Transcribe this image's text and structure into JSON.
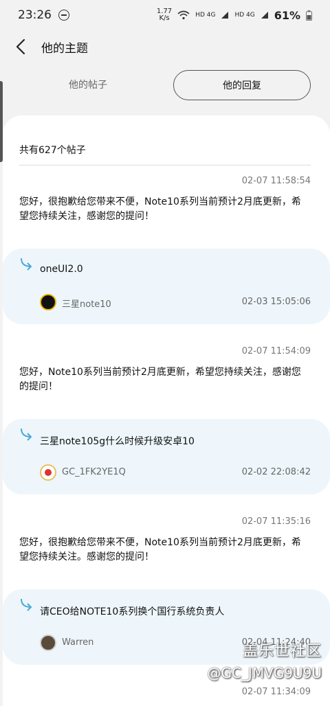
{
  "status": {
    "time": "23:26",
    "net_speed_top": "1.77",
    "net_speed_bottom": "K/s",
    "sim1": "HD 4G",
    "sim2": "HD 4G",
    "battery": "61%"
  },
  "header": {
    "title": "他的主题"
  },
  "tabs": {
    "posts": "他的帖子",
    "replies": "他的回复"
  },
  "summary": "共有627个帖子",
  "entries": [
    {
      "time": "02-07 11:58:54",
      "text": "您好，很抱歉给您带来不便，Note10系列当前预计2月底更新，希望您持续关注，感谢您的提问！",
      "quote": {
        "title": "oneUI2.0",
        "user": "三星note10",
        "time": "02-03 15:05:06"
      }
    },
    {
      "time": "02-07 11:54:09",
      "text": "您好，Note10系列当前预计2月底更新，希望您持续关注，感谢您的提问！",
      "quote": {
        "title": "三星note105g什么时候升级安卓10",
        "user": "GC_1FK2YE1Q",
        "time": "02-02 22:08:42"
      }
    },
    {
      "time": "02-07 11:35:16",
      "text": "您好，很抱歉给您带来不便，Note10系列当前预计2月底更新，希望您持续关注。感谢您的提问！",
      "quote": {
        "title": "请CEO给NOTE10系列换个国行系统负责人",
        "user": "Warren",
        "time": "02-04 11:24:40"
      }
    },
    {
      "time": "02-07 11:34:09"
    }
  ],
  "watermark": {
    "brand": "盖乐世社区",
    "user": "@GC_JMVG9U9U"
  },
  "icons": {
    "back": "chevron-left-icon",
    "quote": "curved-arrow-icon",
    "dnd": "do-not-disturb-icon"
  },
  "colors": {
    "quote_bg": "#eef6fb",
    "accent": "#4aa8d8"
  }
}
